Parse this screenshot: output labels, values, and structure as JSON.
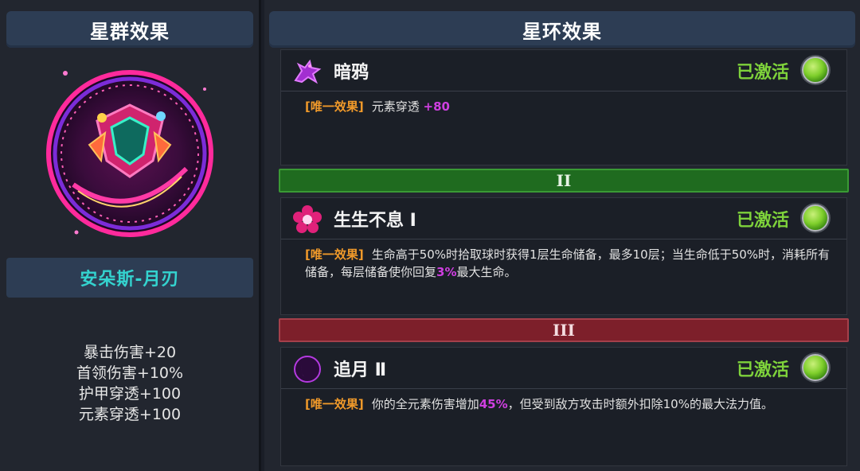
{
  "cluster_panel": {
    "title": "星群效果",
    "constellation_name": "安朵斯-月刃",
    "stats": [
      "暴击伤害+20",
      "首领伤害+10%",
      "护甲穿透+100",
      "元素穿透+100"
    ]
  },
  "ring_panel": {
    "title": "星环效果",
    "tier_labels": [
      "II",
      "III"
    ],
    "effects": [
      {
        "icon": "raven-icon",
        "name": "暗鸦",
        "status": "已激活",
        "tag": "[唯一效果]",
        "desc_parts": [
          "元素穿透 ",
          "+80",
          ""
        ]
      },
      {
        "icon": "flower-icon",
        "name": "生生不息 Ⅰ",
        "status": "已激活",
        "tag": "[唯一效果]",
        "desc_parts": [
          "生命高于50%时拾取球时获得1层生命储备，最多10层；当生命低于50%时，消耗所有储备，每层储备使你回复",
          "3%",
          "最大生命。"
        ]
      },
      {
        "icon": "crescent-moon-icon",
        "name": "追月 Ⅱ",
        "status": "已激活",
        "tag": "[唯一效果]",
        "desc_parts": [
          "你的全元素伤害增加",
          "45%",
          "，但受到敌方攻击时额外扣除10%的最大法力值。"
        ]
      }
    ]
  },
  "colors": {
    "status_active": "#7ed23b",
    "name_cyan": "#34d3cf",
    "tag_orange": "#f19a2a",
    "highlight_purple": "#cf3fe0",
    "tier2_green": "#1f6b1f",
    "tier3_red": "#7d1f2a"
  }
}
